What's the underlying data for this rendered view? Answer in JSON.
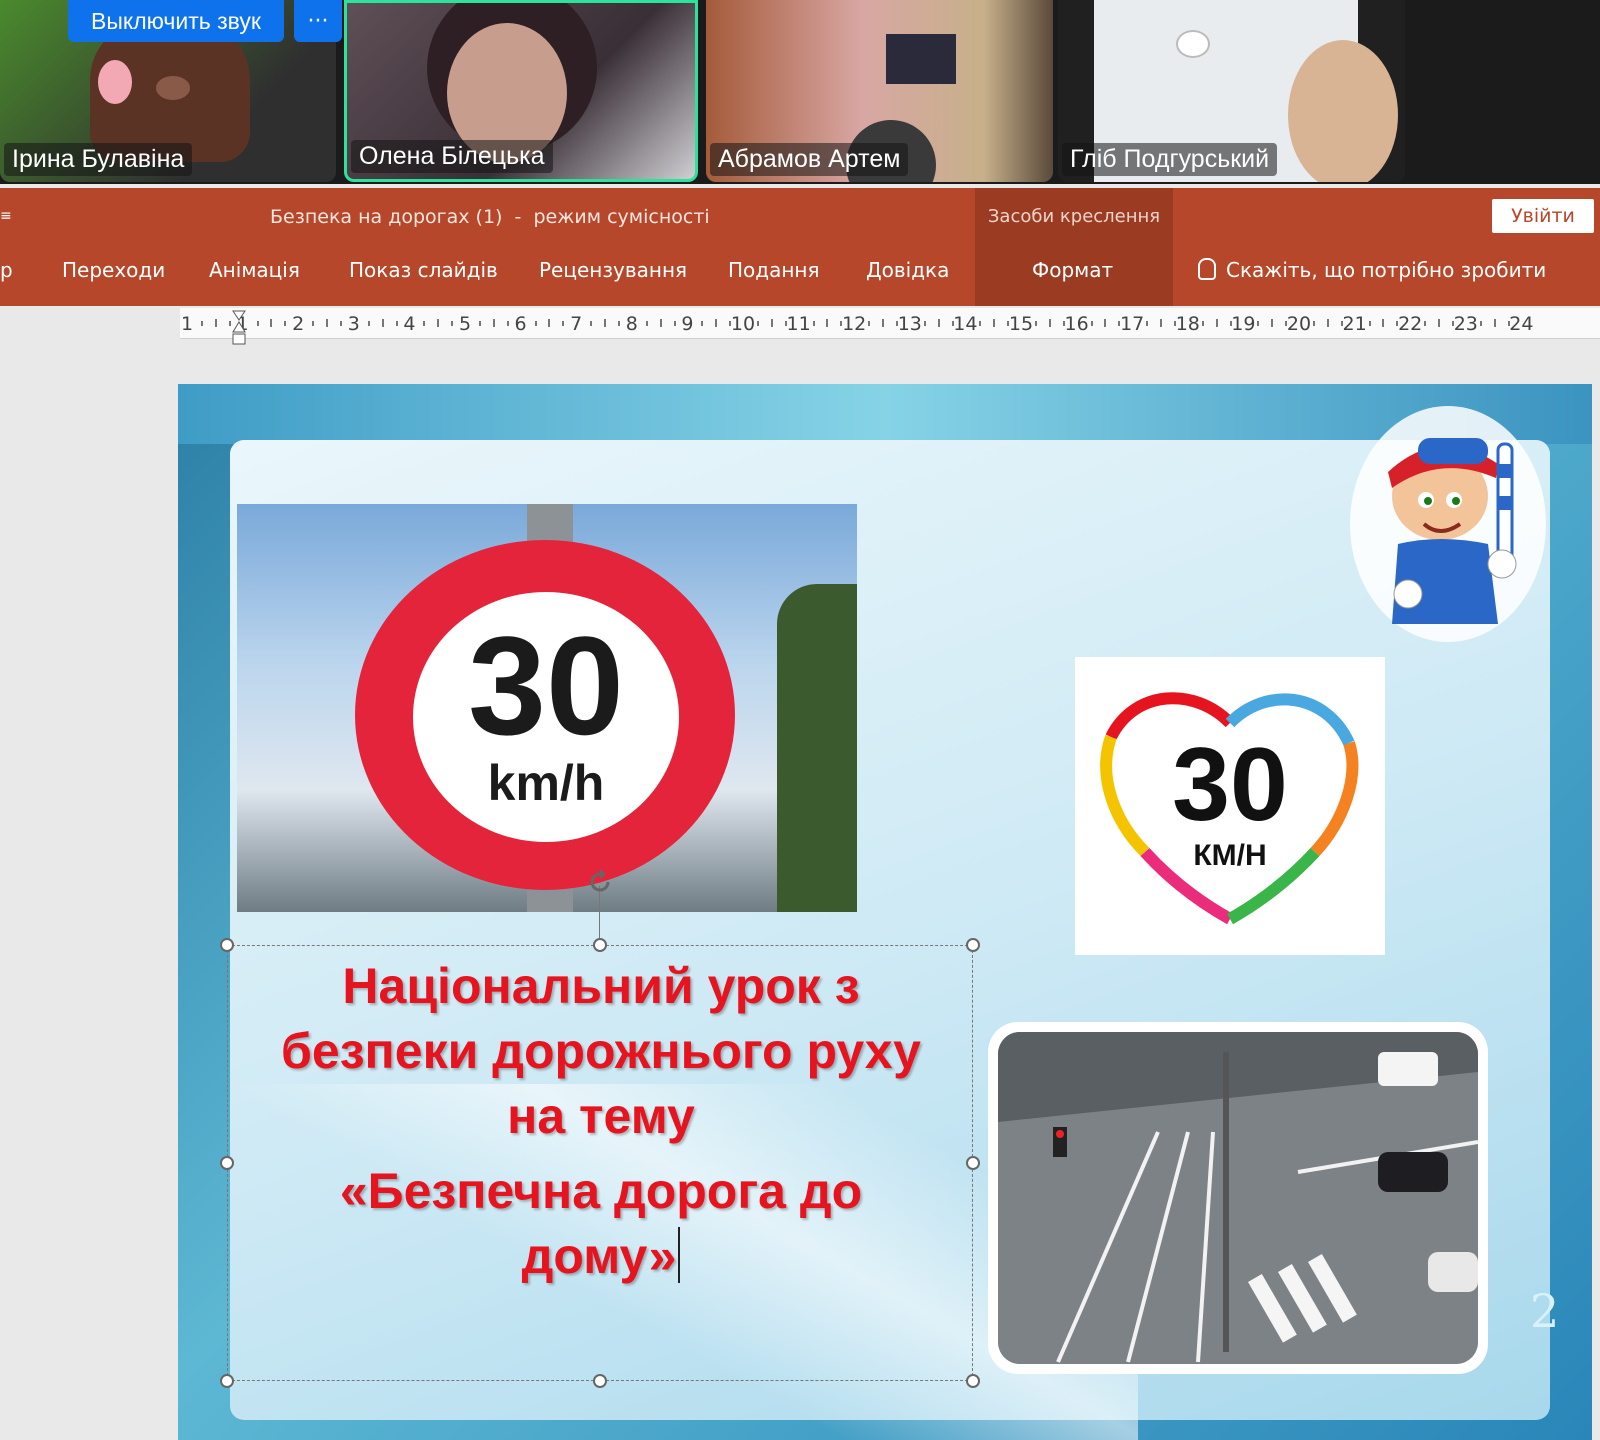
{
  "meeting": {
    "mute_button": "Выключить звук",
    "more_button": "···",
    "participants": [
      {
        "name": "Ірина Булавіна"
      },
      {
        "name": "Олена Білецька"
      },
      {
        "name": "Абрамов Артем"
      },
      {
        "name": "Гліб Подгурський"
      }
    ]
  },
  "app": {
    "title": "Безпека на дорогах (1)  -  режим сумісності",
    "contextual_group": "Засоби креслення",
    "login_button": "Увійти",
    "tabs": [
      {
        "label": "р"
      },
      {
        "label": "Переходи"
      },
      {
        "label": "Анімація"
      },
      {
        "label": "Показ слайдів"
      },
      {
        "label": "Рецензування"
      },
      {
        "label": "Подання"
      },
      {
        "label": "Довідка"
      },
      {
        "label": "Формат"
      }
    ],
    "tell_me": "Скажіть, що потрібно зробити",
    "accent_color": "#b7472a"
  },
  "ruler": {
    "labels": [
      "1",
      "1",
      "2",
      "3",
      "4",
      "5",
      "6",
      "7",
      "8",
      "9",
      "10",
      "11",
      "12",
      "13",
      "14",
      "15",
      "16",
      "17",
      "18",
      "19",
      "20",
      "21",
      "22",
      "23",
      "24"
    ]
  },
  "slide": {
    "sign_number": "30",
    "sign_unit": "km/h",
    "heart_number": "30",
    "heart_unit": "КМ/Н",
    "page_number": "2",
    "title_lines": [
      "Національний урок з",
      "безпеки дорожнього руху",
      "на тему",
      "«Безпечна дорога до",
      "дому»"
    ],
    "title_color": "#e5141e"
  }
}
